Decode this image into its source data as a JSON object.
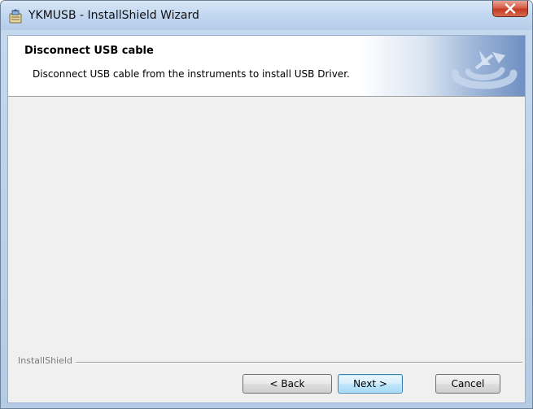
{
  "window": {
    "title": "YKMUSB - InstallShield Wizard",
    "app_icon": "installer-icon",
    "close_icon": "close-icon"
  },
  "banner": {
    "title": "Disconnect USB cable",
    "subtitle": "Disconnect USB cable from the instruments to install USB Driver.",
    "graphic_icon": "installshield-logo-icon"
  },
  "footer": {
    "brand": "InstallShield"
  },
  "buttons": {
    "back_label": "< Back",
    "next_label": "Next >",
    "cancel_label": "Cancel"
  },
  "colors": {
    "titlebar": "#c2d7f0",
    "close_button": "#c23a22",
    "banner_accent": "#6f8fc2",
    "default_button_border": "#3c7fb1"
  }
}
